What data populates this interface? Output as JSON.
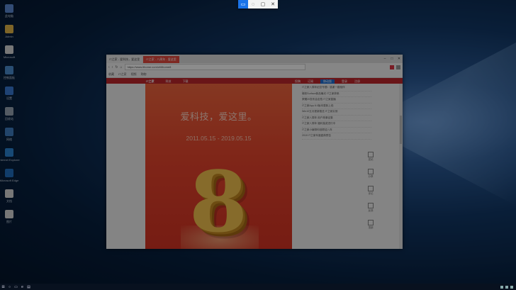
{
  "snip_toolbar": {
    "buttons": [
      {
        "icon": "rectangle-snip-icon",
        "glyph": "▭",
        "active": true
      },
      {
        "icon": "freeform-snip-icon",
        "glyph": "◌",
        "active": false
      },
      {
        "icon": "window-snip-icon",
        "glyph": "▢",
        "active": false
      },
      {
        "icon": "close-icon",
        "glyph": "✕",
        "active": false
      }
    ]
  },
  "desktop": {
    "icons": [
      {
        "name": "recycle-bin-icon",
        "label": "此电脑",
        "color": "#5b8ad6"
      },
      {
        "name": "folder-icon",
        "label": "Admin",
        "color": "#e6b84a"
      },
      {
        "name": "document-icon",
        "label": "Microsoft",
        "color": "#d9d9d9"
      },
      {
        "name": "monitor-icon",
        "label": "控制面板",
        "color": "#4c8fd1"
      },
      {
        "name": "settings-icon",
        "label": "设置",
        "color": "#3a7bd5"
      },
      {
        "name": "trash-icon",
        "label": "回收站",
        "color": "#9aa6b5"
      },
      {
        "name": "network-icon",
        "label": "网络",
        "color": "#3f7fc4"
      },
      {
        "name": "ie-icon",
        "label": "Internet Explorer",
        "color": "#2b86d6"
      },
      {
        "name": "edge-icon",
        "label": "Microsoft Edge",
        "color": "#1f70c1"
      },
      {
        "name": "file-icon",
        "label": "文档",
        "color": "#d9d9d9"
      },
      {
        "name": "file-icon-2",
        "label": "图片",
        "color": "#d9d9d9"
      }
    ]
  },
  "browser": {
    "tabs": [
      {
        "label": "IT之家 - 爱科技，爱这里",
        "active": false
      },
      {
        "label": "IT之家 - 八周年 - 爱这里",
        "active": true
      }
    ],
    "address": "https://www.ithome.com/zt/ithome8",
    "bookmarks": [
      "收藏",
      "IT之家",
      "视频",
      "购物"
    ],
    "site_nav": {
      "brand": "IT之家",
      "left_links": [
        "科技",
        "下载"
      ],
      "right_links": [
        "投稿",
        "订阅",
        "移动版",
        "登录",
        "注册"
      ],
      "highlight": "移动版"
    }
  },
  "banner": {
    "slogan": "爱科技，爱这里。",
    "dates": "2011.05.15 - 2019.05.15",
    "anniversary": "8"
  },
  "news": [
    "IT之家八周年纪念专题：感谢一路相伴",
    "微软Surface新品曝光 IT之家获悉",
    "荣耀20发布会定档 IT之家直播",
    "IT之家App 8.0版本更新上线",
    "Win10五月更新推送 IT之家实测",
    "IT之家八周年 用户故事征集",
    "IT之家八周年 福利抽奖进行中",
    "IT之家小编带你回顾这八年",
    "2019 IT之家年度盛典预告"
  ],
  "sidebar": [
    "发帖",
    "分享",
    "评论",
    "反馈",
    "顶部"
  ]
}
